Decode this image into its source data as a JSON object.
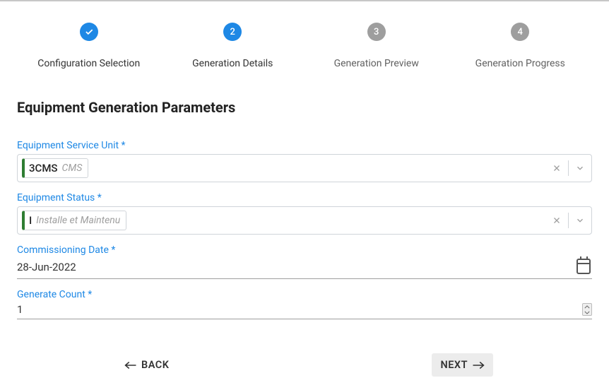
{
  "stepper": {
    "steps": [
      {
        "label": "Configuration Selection",
        "state": "completed",
        "num": ""
      },
      {
        "label": "Generation Details",
        "state": "active",
        "num": "2"
      },
      {
        "label": "Generation Preview",
        "state": "pending",
        "num": "3"
      },
      {
        "label": "Generation Progress",
        "state": "pending",
        "num": "4"
      }
    ]
  },
  "section_title": "Equipment Generation Parameters",
  "fields": {
    "service_unit": {
      "label": "Equipment Service Unit *",
      "tag_main": "3CMS",
      "tag_sub": "CMS"
    },
    "status": {
      "label": "Equipment Status *",
      "tag_main": "I",
      "tag_sub": "Installe et Maintenu"
    },
    "commissioning": {
      "label": "Commissioning Date *",
      "value": "28-Jun-2022"
    },
    "count": {
      "label": "Generate Count *",
      "value": "1"
    }
  },
  "nav": {
    "back": "BACK",
    "next": "NEXT"
  }
}
